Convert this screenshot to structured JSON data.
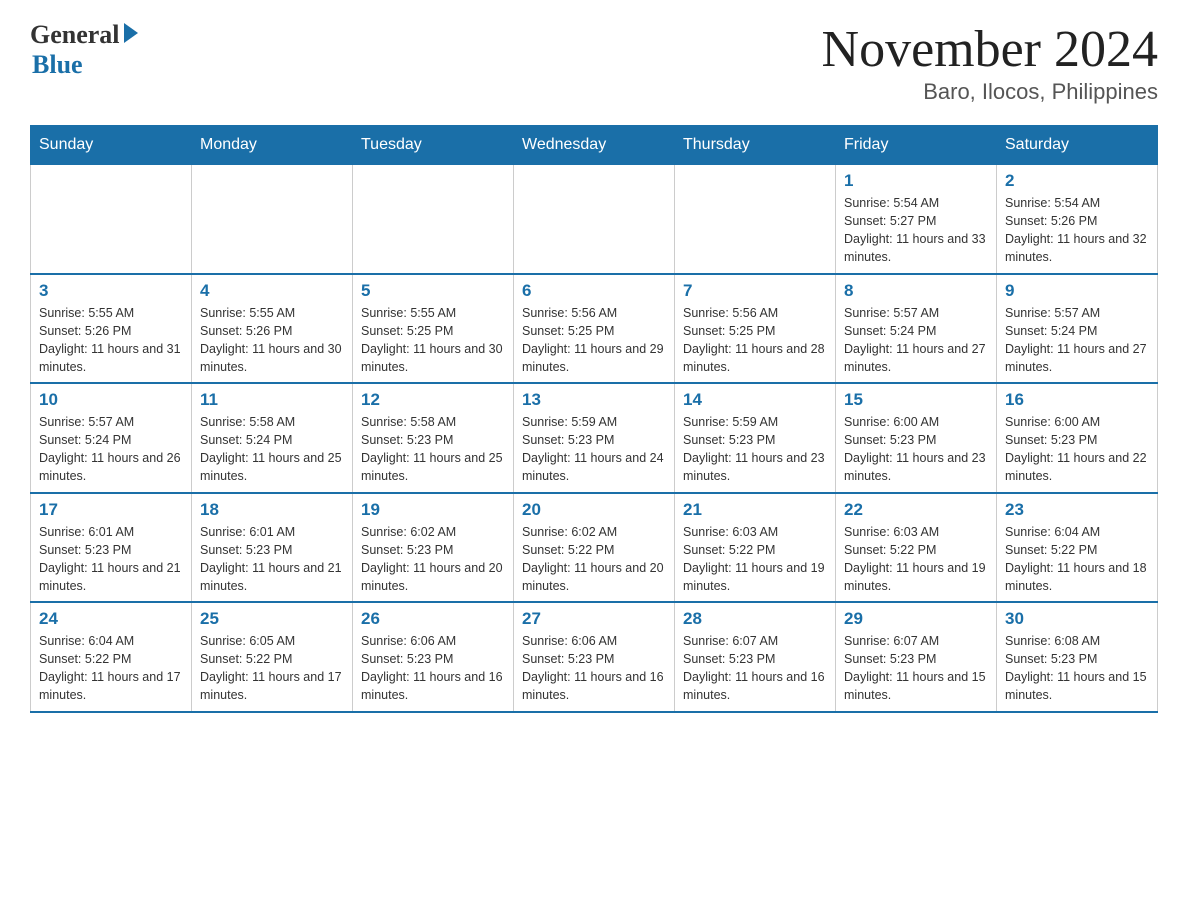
{
  "logo": {
    "general": "General",
    "blue": "Blue"
  },
  "title": "November 2024",
  "subtitle": "Baro, Ilocos, Philippines",
  "days_header": [
    "Sunday",
    "Monday",
    "Tuesday",
    "Wednesday",
    "Thursday",
    "Friday",
    "Saturday"
  ],
  "weeks": [
    [
      {
        "num": "",
        "info": ""
      },
      {
        "num": "",
        "info": ""
      },
      {
        "num": "",
        "info": ""
      },
      {
        "num": "",
        "info": ""
      },
      {
        "num": "",
        "info": ""
      },
      {
        "num": "1",
        "info": "Sunrise: 5:54 AM\nSunset: 5:27 PM\nDaylight: 11 hours and 33 minutes."
      },
      {
        "num": "2",
        "info": "Sunrise: 5:54 AM\nSunset: 5:26 PM\nDaylight: 11 hours and 32 minutes."
      }
    ],
    [
      {
        "num": "3",
        "info": "Sunrise: 5:55 AM\nSunset: 5:26 PM\nDaylight: 11 hours and 31 minutes."
      },
      {
        "num": "4",
        "info": "Sunrise: 5:55 AM\nSunset: 5:26 PM\nDaylight: 11 hours and 30 minutes."
      },
      {
        "num": "5",
        "info": "Sunrise: 5:55 AM\nSunset: 5:25 PM\nDaylight: 11 hours and 30 minutes."
      },
      {
        "num": "6",
        "info": "Sunrise: 5:56 AM\nSunset: 5:25 PM\nDaylight: 11 hours and 29 minutes."
      },
      {
        "num": "7",
        "info": "Sunrise: 5:56 AM\nSunset: 5:25 PM\nDaylight: 11 hours and 28 minutes."
      },
      {
        "num": "8",
        "info": "Sunrise: 5:57 AM\nSunset: 5:24 PM\nDaylight: 11 hours and 27 minutes."
      },
      {
        "num": "9",
        "info": "Sunrise: 5:57 AM\nSunset: 5:24 PM\nDaylight: 11 hours and 27 minutes."
      }
    ],
    [
      {
        "num": "10",
        "info": "Sunrise: 5:57 AM\nSunset: 5:24 PM\nDaylight: 11 hours and 26 minutes."
      },
      {
        "num": "11",
        "info": "Sunrise: 5:58 AM\nSunset: 5:24 PM\nDaylight: 11 hours and 25 minutes."
      },
      {
        "num": "12",
        "info": "Sunrise: 5:58 AM\nSunset: 5:23 PM\nDaylight: 11 hours and 25 minutes."
      },
      {
        "num": "13",
        "info": "Sunrise: 5:59 AM\nSunset: 5:23 PM\nDaylight: 11 hours and 24 minutes."
      },
      {
        "num": "14",
        "info": "Sunrise: 5:59 AM\nSunset: 5:23 PM\nDaylight: 11 hours and 23 minutes."
      },
      {
        "num": "15",
        "info": "Sunrise: 6:00 AM\nSunset: 5:23 PM\nDaylight: 11 hours and 23 minutes."
      },
      {
        "num": "16",
        "info": "Sunrise: 6:00 AM\nSunset: 5:23 PM\nDaylight: 11 hours and 22 minutes."
      }
    ],
    [
      {
        "num": "17",
        "info": "Sunrise: 6:01 AM\nSunset: 5:23 PM\nDaylight: 11 hours and 21 minutes."
      },
      {
        "num": "18",
        "info": "Sunrise: 6:01 AM\nSunset: 5:23 PM\nDaylight: 11 hours and 21 minutes."
      },
      {
        "num": "19",
        "info": "Sunrise: 6:02 AM\nSunset: 5:23 PM\nDaylight: 11 hours and 20 minutes."
      },
      {
        "num": "20",
        "info": "Sunrise: 6:02 AM\nSunset: 5:22 PM\nDaylight: 11 hours and 20 minutes."
      },
      {
        "num": "21",
        "info": "Sunrise: 6:03 AM\nSunset: 5:22 PM\nDaylight: 11 hours and 19 minutes."
      },
      {
        "num": "22",
        "info": "Sunrise: 6:03 AM\nSunset: 5:22 PM\nDaylight: 11 hours and 19 minutes."
      },
      {
        "num": "23",
        "info": "Sunrise: 6:04 AM\nSunset: 5:22 PM\nDaylight: 11 hours and 18 minutes."
      }
    ],
    [
      {
        "num": "24",
        "info": "Sunrise: 6:04 AM\nSunset: 5:22 PM\nDaylight: 11 hours and 17 minutes."
      },
      {
        "num": "25",
        "info": "Sunrise: 6:05 AM\nSunset: 5:22 PM\nDaylight: 11 hours and 17 minutes."
      },
      {
        "num": "26",
        "info": "Sunrise: 6:06 AM\nSunset: 5:23 PM\nDaylight: 11 hours and 16 minutes."
      },
      {
        "num": "27",
        "info": "Sunrise: 6:06 AM\nSunset: 5:23 PM\nDaylight: 11 hours and 16 minutes."
      },
      {
        "num": "28",
        "info": "Sunrise: 6:07 AM\nSunset: 5:23 PM\nDaylight: 11 hours and 16 minutes."
      },
      {
        "num": "29",
        "info": "Sunrise: 6:07 AM\nSunset: 5:23 PM\nDaylight: 11 hours and 15 minutes."
      },
      {
        "num": "30",
        "info": "Sunrise: 6:08 AM\nSunset: 5:23 PM\nDaylight: 11 hours and 15 minutes."
      }
    ]
  ]
}
